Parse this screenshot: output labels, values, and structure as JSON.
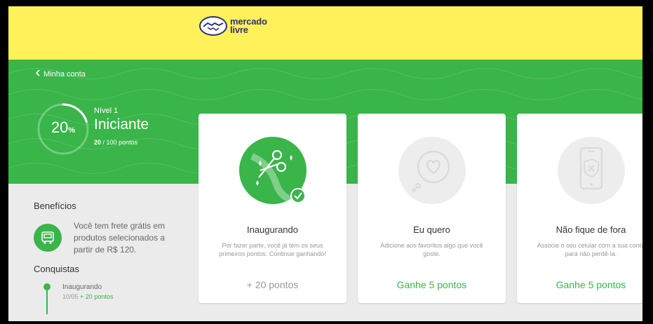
{
  "header": {
    "logo_line1": "mercado",
    "logo_line2": "livre"
  },
  "nav": {
    "back_label": "Minha conta"
  },
  "level": {
    "progress_fraction": 0.2,
    "percent": "20",
    "percent_unit": "%",
    "number_label": "Nível 1",
    "name": "Iniciante",
    "points_current": "20",
    "points_total": "/ 100 pontos"
  },
  "benefits": {
    "title": "Benefícios",
    "icon": "truck-icon",
    "text": "Você tem frete grátis em produtos selecionados a partir de R$ 120."
  },
  "achievements": {
    "title": "Conquistas",
    "items": [
      {
        "name": "Inaugurando",
        "date": "10/05",
        "points": "+ 20 pontos"
      }
    ]
  },
  "cards": [
    {
      "title": "Inaugurando",
      "description": "Por fazer parte, você já tem os seus primeiros pontos. Continue ganhando!",
      "points": "+ 20 pontos",
      "icon": "scissors-ribbon-icon",
      "completed": true
    },
    {
      "title": "Eu quero",
      "description": "Adicione aos favoritos algo que você goste.",
      "points": "Ganhe 5 pontos",
      "icon": "heart-icon",
      "completed": false
    },
    {
      "title": "Não fique de fora",
      "description": "Associe o seu celular com a sua conta para não perdê-la.",
      "points": "Ganhe 5 pontos",
      "icon": "phone-shield-icon",
      "completed": false
    }
  ],
  "colors": {
    "brand_yellow": "#fff159",
    "accent_green": "#39b54a",
    "logo_blue": "#2d3277"
  }
}
